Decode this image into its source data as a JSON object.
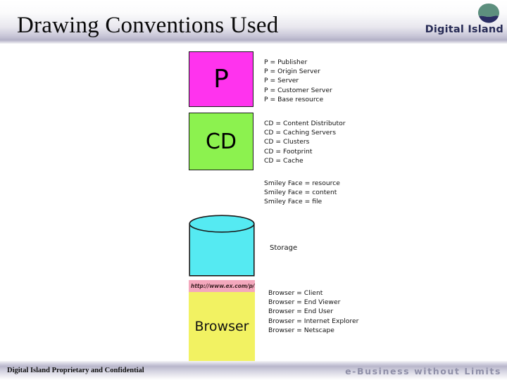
{
  "header": {
    "title": "Drawing Conventions Used",
    "logo_text": "Digital Island",
    "logo_mark_name": "digital-island-globe-icon",
    "logo_colors": {
      "top": "#5d8f7e",
      "bottom": "#2a2d63"
    }
  },
  "shapes": {
    "publisher": {
      "label": "P",
      "fill": "#ff33ee",
      "border": "#1a1a1a"
    },
    "content_distributor": {
      "label": "CD",
      "fill": "#8cf24f",
      "border": "#1a1a1a"
    },
    "smiley": {
      "fill": "#f2f062",
      "face": "smiley-face-icon"
    },
    "storage": {
      "fill": "#55eaf2",
      "border": "#1a1a1a",
      "shape": "cylinder"
    },
    "browser": {
      "url": "http://www.ex.com/p/r",
      "label": "Browser",
      "urlbar_fill": "#f4a8bd",
      "body_fill": "#f2f262"
    }
  },
  "legends": {
    "publisher": [
      "P = Publisher",
      "P = Origin Server",
      "P = Server",
      "P = Customer Server",
      "P = Base resource"
    ],
    "content_distributor": [
      "CD = Content Distributor",
      "CD = Caching Servers",
      "CD = Clusters",
      "CD = Footprint",
      "CD = Cache"
    ],
    "smiley": [
      "Smiley Face = resource",
      "Smiley Face = content",
      "Smiley Face = file"
    ],
    "storage": [
      "Storage"
    ],
    "browser": [
      "Browser = Client",
      "Browser = End Viewer",
      "Browser = End User",
      "Browser = Internet Explorer",
      "Browser = Netscape"
    ]
  },
  "footer": {
    "left": "Digital Island Proprietary and Confidential",
    "right": "e-Business without Limits"
  }
}
